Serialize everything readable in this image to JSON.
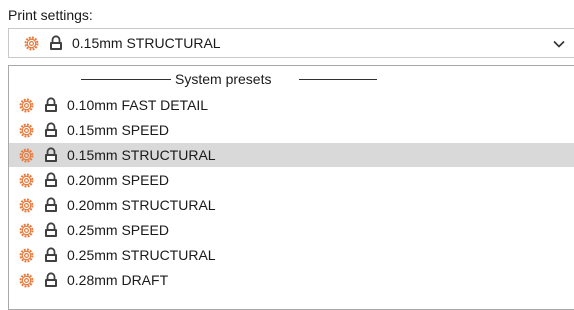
{
  "label": "Print settings:",
  "combo": {
    "selected": "0.15mm STRUCTURAL",
    "chevron_icon": "chevron-down-icon"
  },
  "dropdown": {
    "group_header": "System presets",
    "items": [
      {
        "label": "0.10mm FAST DETAIL",
        "selected": false
      },
      {
        "label": "0.15mm SPEED",
        "selected": false
      },
      {
        "label": "0.15mm STRUCTURAL",
        "selected": true
      },
      {
        "label": "0.20mm SPEED",
        "selected": false
      },
      {
        "label": "0.20mm STRUCTURAL",
        "selected": false
      },
      {
        "label": "0.25mm SPEED",
        "selected": false
      },
      {
        "label": "0.25mm STRUCTURAL",
        "selected": false
      },
      {
        "label": "0.28mm DRAFT",
        "selected": false
      }
    ]
  },
  "colors": {
    "gear": "#e8773a",
    "lock": "#404040",
    "selected_bg": "#d9d9d9"
  },
  "icons": {
    "preset_icon": "gear-icon",
    "system_icon": "lock-icon"
  }
}
